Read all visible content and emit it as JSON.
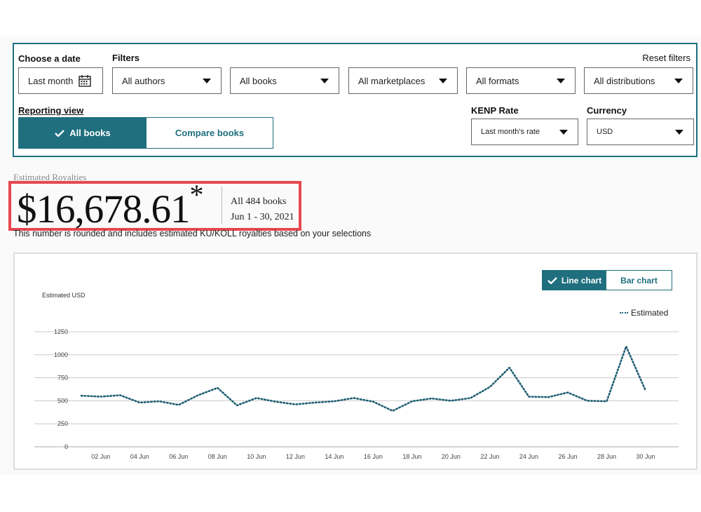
{
  "filters": {
    "choose_date_label": "Choose a date",
    "filters_label": "Filters",
    "reset_label": "Reset filters",
    "date_value": "Last month",
    "authors_value": "All authors",
    "books_value": "All books",
    "marketplaces_value": "All marketplaces",
    "formats_value": "All formats",
    "distributions_value": "All distributions",
    "reporting_view_label": "Reporting view",
    "view_all_books": "All books",
    "view_compare_books": "Compare books",
    "kenp_label": "KENP Rate",
    "kenp_value": "Last month's rate",
    "currency_label": "Currency",
    "currency_value": "USD"
  },
  "royalties": {
    "label": "Estimated Royalties",
    "amount": "$16,678.61",
    "asterisk": "*",
    "books": "All 484 books",
    "date_range": "Jun 1 - 30, 2021",
    "note": "This number is rounded and includes estimated KU/KOLL royalties based on your selections"
  },
  "chart_controls": {
    "line_chart": "Line chart",
    "bar_chart": "Bar chart",
    "y_axis_label": "Estimated USD",
    "legend_label": "Estimated"
  },
  "colors": {
    "accent": "#1f6f7e",
    "line": "#1f5e73",
    "highlight_box": "#e8474f"
  },
  "chart_data": {
    "type": "line",
    "title": "",
    "ylabel": "Estimated USD",
    "xlabel": "",
    "ylim": [
      0,
      1250
    ],
    "yticks": [
      0,
      250,
      500,
      750,
      1000,
      1250
    ],
    "x_tick_labels": [
      "02 Jun",
      "04 Jun",
      "06 Jun",
      "08 Jun",
      "10 Jun",
      "12 Jun",
      "14 Jun",
      "16 Jun",
      "18 Jun",
      "20 Jun",
      "22 Jun",
      "24 Jun",
      "26 Jun",
      "28 Jun",
      "30 Jun"
    ],
    "grid": true,
    "legend_position": "top-right",
    "series": [
      {
        "name": "Estimated",
        "x": [
          1,
          2,
          3,
          4,
          5,
          6,
          7,
          8,
          9,
          10,
          11,
          12,
          13,
          14,
          15,
          16,
          17,
          18,
          19,
          20,
          21,
          22,
          23,
          24,
          25,
          26,
          27,
          28,
          29,
          30
        ],
        "values": [
          555,
          545,
          560,
          480,
          495,
          455,
          560,
          640,
          450,
          530,
          490,
          460,
          480,
          495,
          530,
          490,
          390,
          495,
          525,
          500,
          530,
          650,
          860,
          545,
          540,
          590,
          500,
          495,
          1090,
          610
        ]
      }
    ]
  }
}
